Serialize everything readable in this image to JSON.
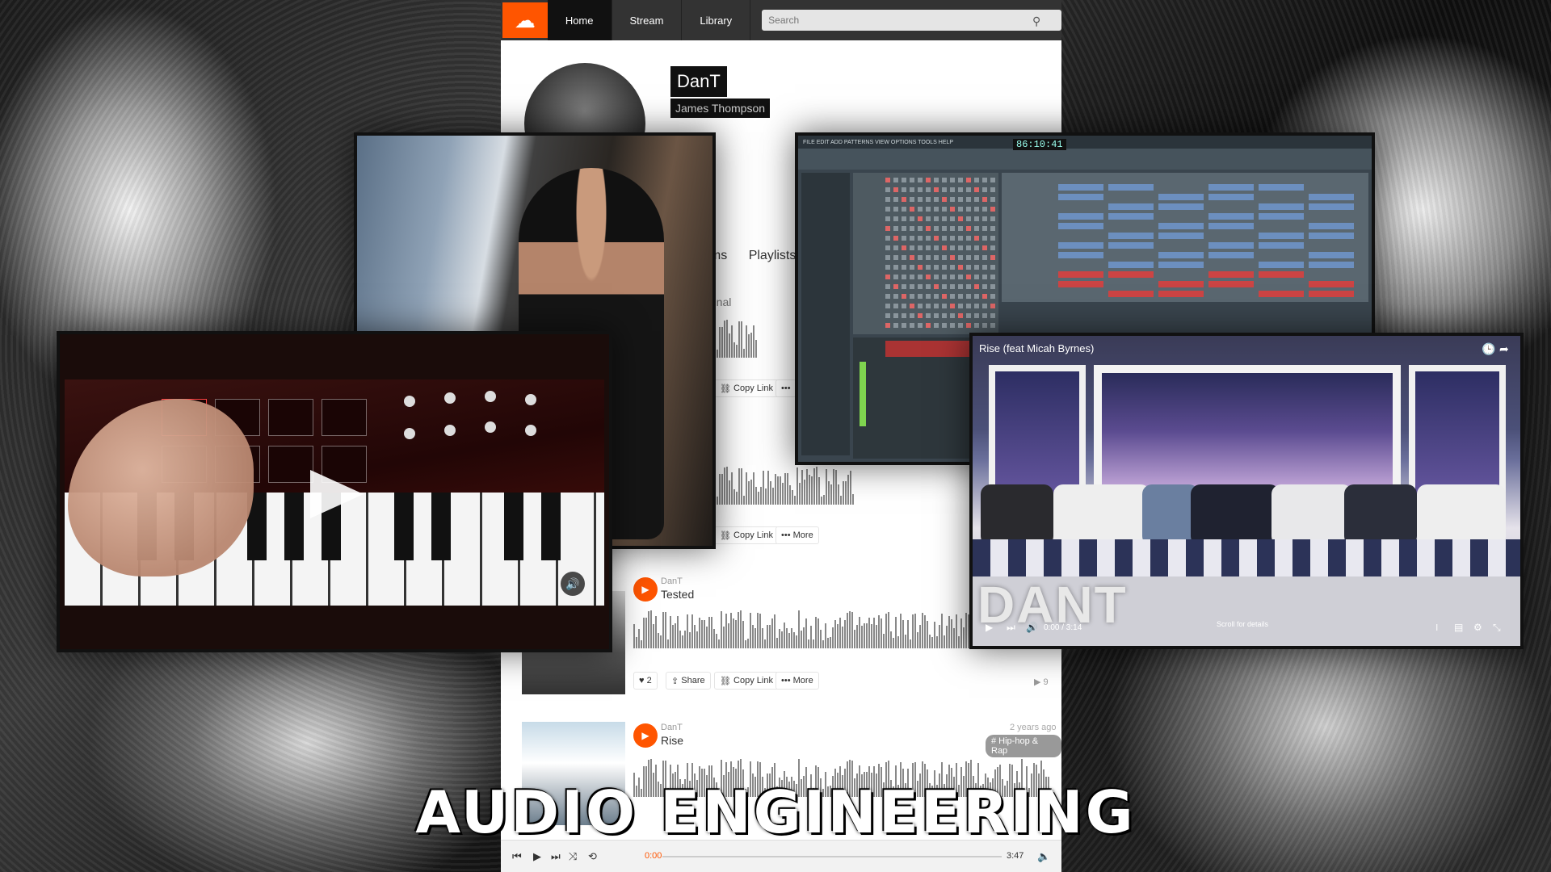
{
  "headline": "AUDIO ENGINEERING",
  "soundcloud": {
    "nav": [
      "Home",
      "Stream",
      "Library"
    ],
    "search_placeholder": "Search",
    "profile_name": "DanT",
    "profile_realname": "James Thompson",
    "tabs": [
      "ums",
      "Playlists"
    ],
    "repost_label": "riginal",
    "actions": {
      "copy_link": "Copy Link",
      "more": "More",
      "share": "Share",
      "more_dots": "•••"
    },
    "tracks": [
      {
        "user": "DanT",
        "title": "Tested",
        "likes": "2",
        "plays": "9"
      },
      {
        "user": "DanT",
        "title": "Rise",
        "age": "2 years ago",
        "tag": "# Hip-hop & Rap"
      }
    ],
    "player": {
      "current": "0:00",
      "duration": "3:47"
    }
  },
  "daw": {
    "menu": "FILE EDIT ADD PATTERNS VIEW OPTIONS TOOLS HELP",
    "time": "86:10:41"
  },
  "youtube": {
    "title": "Rise (feat Micah Byrnes)",
    "brand": "DANT",
    "time": "0:00 / 3:14",
    "scroll_hint": "Scroll for details"
  },
  "colors": {
    "soundcloud_orange": "#ff5500",
    "dark_bar": "#333333"
  }
}
